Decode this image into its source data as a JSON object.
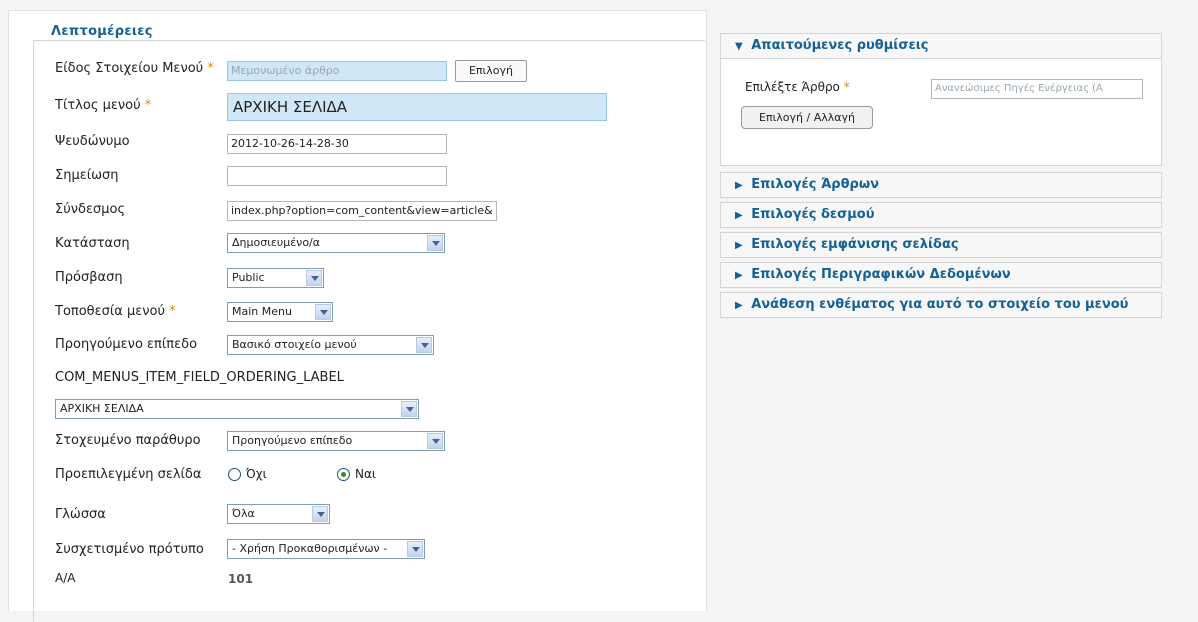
{
  "details": {
    "legend": "Λεπτομέρειες",
    "menu_type_label": "Είδος Στοιχείου Μενού",
    "menu_type_value": "Μεμονωμένο άρθρο",
    "menu_type_button": "Επιλογή",
    "title_label": "Τίτλος μενού",
    "title_value": "ΑΡΧΙΚΗ ΣΕΛΙΔΑ",
    "alias_label": "Ψευδώνυμο",
    "alias_value": "2012-10-26-14-28-30",
    "note_label": "Σημείωση",
    "note_value": "",
    "link_label": "Σύνδεσμος",
    "link_value": "index.php?option=com_content&view=article&",
    "status_label": "Κατάσταση",
    "status_value": "Δημοσιευμένο/α",
    "access_label": "Πρόσβαση",
    "access_value": "Public",
    "menu_location_label": "Τοποθεσία μενού",
    "menu_location_value": "Main Menu",
    "parent_label": "Προηγούμενο επίπεδο",
    "parent_value": "Βασικό στοιχείο μενού",
    "ordering_label": "COM_MENUS_ITEM_FIELD_ORDERING_LABEL",
    "ordering_value": "ΑΡΧΙΚΗ ΣΕΛΙΔΑ",
    "target_label": "Στοχευμένο παράθυρο",
    "target_value": "Προηγούμενο επίπεδο",
    "default_label": "Προεπιλεγμένη σελίδα",
    "default_no": "Όχι",
    "default_yes": "Ναι",
    "default_selected": "yes",
    "language_label": "Γλώσσα",
    "language_value": "Όλα",
    "template_label": "Συσχετισμένο πρότυπο",
    "template_value": "- Χρήση Προκαθορισμένων -",
    "id_label": "Α/Α",
    "id_value": "101",
    "required_mark": "*"
  },
  "right": {
    "required_panel": {
      "title": "Απαιτούμενες ρυθμίσεις",
      "select_article_label": "Επιλέξτε Άρθρο",
      "select_article_value": "Ανανεώσιμες Πηγές Ενέργειας (Α",
      "change_button": "Επιλογή / Αλλαγή"
    },
    "panels": [
      "Επιλογές Άρθρων",
      "Επιλογές δεσμού",
      "Επιλογές εμφάνισης σελίδας",
      "Επιλογές Περιγραφικών Δεδομένων",
      "Ανάθεση ενθέματος για αυτό το στοιχείο του μενού"
    ]
  },
  "icons": {
    "expanded": "triangle-down",
    "collapsed": "triangle-right"
  },
  "colors": {
    "heading": "#146295",
    "required": "#e08a18",
    "readonly_bg": "#cfe7f6"
  }
}
